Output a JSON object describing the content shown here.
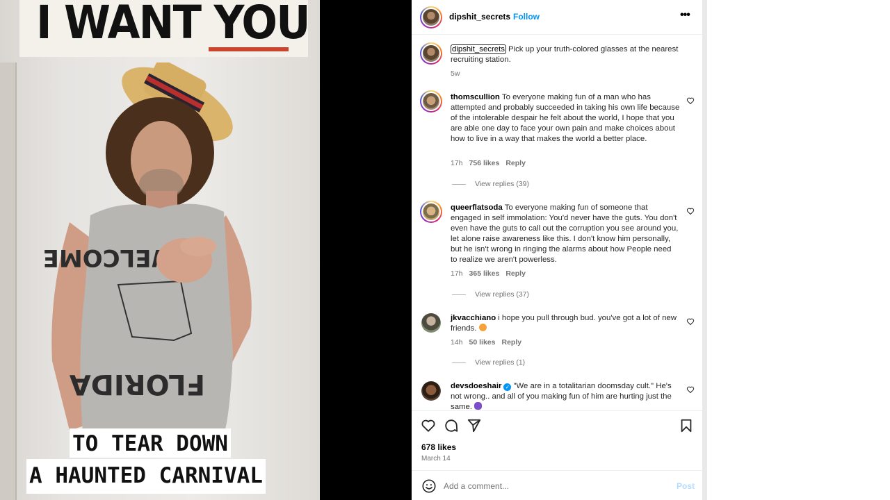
{
  "media": {
    "top_text_part1": "I WANT ",
    "top_text_part2": "YOU",
    "caption_line1": "TO TEAR DOWN",
    "caption_line2": "A HAUNTED CARNIVAL"
  },
  "header": {
    "username": "dipshit_secrets",
    "separator": "•",
    "follow_label": "Follow",
    "more_label": "•••"
  },
  "caption": {
    "username": "dipshit_secrets",
    "text": "Pick up your truth-colored glasses at the nearest recruiting station.",
    "time": "5w"
  },
  "comments": [
    {
      "username": "thomscullion",
      "text": "To everyone making fun of a man who has attempted and probably succeeded in taking his own life because of the intolerable despair he felt about the world, I hope that you are able one day to face your own pain and make choices about how to live in a way that makes the world a better place.",
      "time": "17h",
      "likes": "756 likes",
      "reply": "Reply",
      "view_replies": "View replies (39)"
    },
    {
      "username": "queerflatsoda",
      "text": "To everyone making fun of someone that engaged in self immolation: You'd never have the guts. You don't even have the guts to call out the corruption you see around you, let alone raise awareness like this. I don't know him personally, but he isn't wrong in ringing the alarms about how People need to realize we aren't powerless.",
      "time": "17h",
      "likes": "365 likes",
      "reply": "Reply",
      "view_replies": "View replies (37)"
    },
    {
      "username": "jkvacchiano",
      "text": "i hope you pull through bud. you've got a lot of new friends.",
      "time": "14h",
      "likes": "50 likes",
      "reply": "Reply",
      "view_replies": "View replies (1)"
    },
    {
      "username": "devsdoeshair",
      "verified_glyph": "✓",
      "text": "\"We are in a totalitarian doomsday cult.\" He's not wrong.. and all of you making fun of him are hurting just the same."
    }
  ],
  "post": {
    "likes": "678 likes",
    "date": "March 14"
  },
  "add_comment": {
    "placeholder": "Add a comment...",
    "post_label": "Post"
  },
  "icons": {
    "heart": "heart-icon",
    "comment": "comment-icon",
    "share": "share-icon",
    "save": "bookmark-icon",
    "emoji": "emoji-icon",
    "more": "more-icon"
  },
  "colors": {
    "follow": "#0095f6",
    "post_disabled": "#b3dbff",
    "muted_text": "#737373",
    "caption_underline": "#c9452e"
  }
}
